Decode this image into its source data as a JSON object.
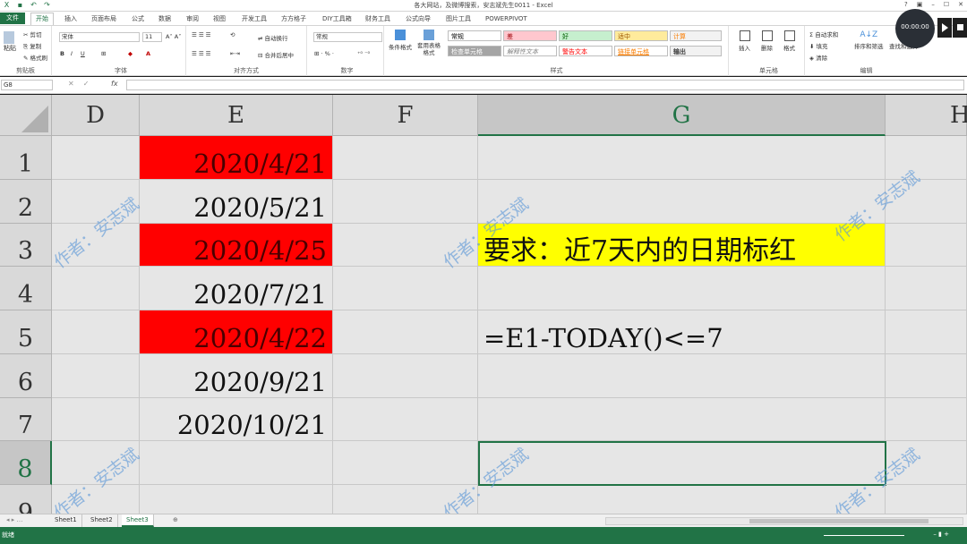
{
  "window": {
    "title": "各大网站，及微博搜索，安志斌先生0011 - Excel",
    "controls": [
      "?",
      "▣",
      "–",
      "☐",
      "✕"
    ]
  },
  "ribbon_tabs": [
    "文件",
    "开始",
    "插入",
    "页面布局",
    "公式",
    "数据",
    "审阅",
    "视图",
    "开发工具",
    "方方格子",
    "DIY工具箱",
    "财务工具",
    "公式向导",
    "图片工具",
    "POWERPIVOT"
  ],
  "ribbon": {
    "clipboard": {
      "paste": "粘贴",
      "cut": "剪切",
      "copy": "复制",
      "format_painter": "格式刷",
      "label": "剪贴板"
    },
    "font": {
      "name": "宋体",
      "size": "11",
      "label": "字体"
    },
    "alignment": {
      "wrap": "自动换行",
      "merge": "合并后居中",
      "label": "对齐方式"
    },
    "number": {
      "format": "常规",
      "label": "数字"
    },
    "styles": {
      "conditional": "条件格式",
      "table": "套用表格格式",
      "cells": [
        {
          "text": "常规",
          "bg": "#ffffff",
          "fg": "#000000"
        },
        {
          "text": "差",
          "bg": "#ffc7ce",
          "fg": "#9c0006"
        },
        {
          "text": "好",
          "bg": "#c6efce",
          "fg": "#006100"
        },
        {
          "text": "适中",
          "bg": "#ffeb9c",
          "fg": "#9c5700"
        },
        {
          "text": "计算",
          "bg": "#f2f2f2",
          "fg": "#fa7d00"
        },
        {
          "text": "检查单元格",
          "bg": "#a5a5a5",
          "fg": "#ffffff"
        },
        {
          "text": "解释性文本",
          "bg": "#ffffff",
          "fg": "#7f7f7f"
        },
        {
          "text": "警告文本",
          "bg": "#ffffff",
          "fg": "#ff0000"
        },
        {
          "text": "链接单元格",
          "bg": "#ffffff",
          "fg": "#fa7d00"
        },
        {
          "text": "输出",
          "bg": "#f2f2f2",
          "fg": "#3f3f3f"
        }
      ],
      "label": "样式"
    },
    "cells_grp": {
      "insert": "插入",
      "delete": "删除",
      "format": "格式",
      "label": "单元格"
    },
    "editing": {
      "autosum": "自动求和",
      "fill": "填充",
      "clear": "清除",
      "sort": "排序和筛选",
      "find": "查找和选择",
      "label": "编辑"
    }
  },
  "formula_bar": {
    "name_box": "G8",
    "fx": "fx",
    "formula": ""
  },
  "columns": [
    "D",
    "E",
    "F",
    "G",
    "H"
  ],
  "rows": [
    "1",
    "2",
    "3",
    "4",
    "5",
    "6",
    "7",
    "8",
    "9"
  ],
  "column_e": [
    "2020/4/21",
    "2020/5/21",
    "2020/4/25",
    "2020/7/21",
    "2020/4/22",
    "2020/9/21",
    "2020/10/21"
  ],
  "highlighted_rows": [
    1,
    3,
    5
  ],
  "g3_text": "要求：近7天内的日期标红",
  "g5_text": "=E1-TODAY()<=7",
  "watermark": "作者：安志斌",
  "sheets": [
    "Sheet1",
    "Sheet2",
    "Sheet3"
  ],
  "active_sheet": "Sheet3",
  "status": {
    "ready": "就绪"
  },
  "player": {
    "time": "00:00:00"
  }
}
